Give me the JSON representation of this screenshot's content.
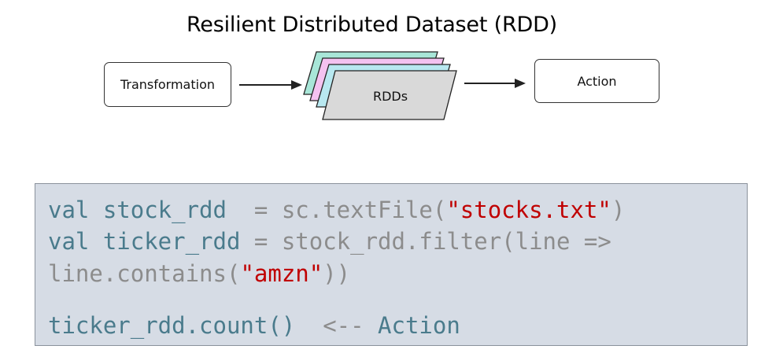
{
  "title": "Resilient Distributed Dataset (RDD)",
  "diagram": {
    "transformation_label": "Transformation",
    "rdds_label": "RDDs",
    "action_label": "Action"
  },
  "code": {
    "line1": {
      "kw": "val stock_rdd",
      "mid": "  = sc.textFile(",
      "str": "\"stocks.txt\"",
      "end": ")"
    },
    "line2": {
      "kw": "val ticker_rdd",
      "rest": " = stock_rdd.filter(line =>"
    },
    "line3": {
      "pre": "line.contains(",
      "str": "\"amzn\"",
      "end": "))"
    },
    "line4": {
      "kw": "ticker_rdd.count()",
      "mid": "  <-- ",
      "tail": "Action"
    }
  },
  "colors": {
    "stack_layers": [
      "#a8e6d8",
      "#f4c2f0",
      "#b8e8f0",
      "#d9d9d9"
    ],
    "code_bg": "#d6dce5",
    "keyword": "#4a7b8c",
    "string": "#c00000",
    "plain": "#8c8c8c"
  }
}
